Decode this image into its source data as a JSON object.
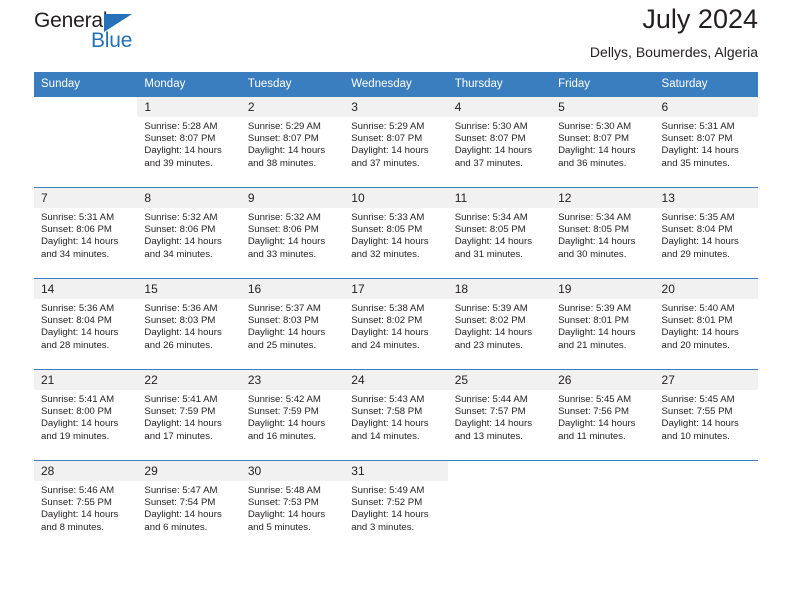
{
  "brand": {
    "name_dark": "General",
    "name_blue": "Blue",
    "accent_color": "#2572b8"
  },
  "header": {
    "title": "July 2024",
    "subtitle": "Dellys, Boumerdes, Algeria"
  },
  "colors": {
    "header_row": "#3a7ebf",
    "day_number_band": "#f1f1f1",
    "text": "#231f20"
  },
  "weekday_headers": [
    "Sunday",
    "Monday",
    "Tuesday",
    "Wednesday",
    "Thursday",
    "Friday",
    "Saturday"
  ],
  "weeks": [
    [
      {
        "day": "",
        "sunrise": "",
        "sunset": "",
        "daylight_line1": "",
        "daylight_line2": ""
      },
      {
        "day": "1",
        "sunrise": "Sunrise: 5:28 AM",
        "sunset": "Sunset: 8:07 PM",
        "daylight_line1": "Daylight: 14 hours",
        "daylight_line2": "and 39 minutes."
      },
      {
        "day": "2",
        "sunrise": "Sunrise: 5:29 AM",
        "sunset": "Sunset: 8:07 PM",
        "daylight_line1": "Daylight: 14 hours",
        "daylight_line2": "and 38 minutes."
      },
      {
        "day": "3",
        "sunrise": "Sunrise: 5:29 AM",
        "sunset": "Sunset: 8:07 PM",
        "daylight_line1": "Daylight: 14 hours",
        "daylight_line2": "and 37 minutes."
      },
      {
        "day": "4",
        "sunrise": "Sunrise: 5:30 AM",
        "sunset": "Sunset: 8:07 PM",
        "daylight_line1": "Daylight: 14 hours",
        "daylight_line2": "and 37 minutes."
      },
      {
        "day": "5",
        "sunrise": "Sunrise: 5:30 AM",
        "sunset": "Sunset: 8:07 PM",
        "daylight_line1": "Daylight: 14 hours",
        "daylight_line2": "and 36 minutes."
      },
      {
        "day": "6",
        "sunrise": "Sunrise: 5:31 AM",
        "sunset": "Sunset: 8:07 PM",
        "daylight_line1": "Daylight: 14 hours",
        "daylight_line2": "and 35 minutes."
      }
    ],
    [
      {
        "day": "7",
        "sunrise": "Sunrise: 5:31 AM",
        "sunset": "Sunset: 8:06 PM",
        "daylight_line1": "Daylight: 14 hours",
        "daylight_line2": "and 34 minutes."
      },
      {
        "day": "8",
        "sunrise": "Sunrise: 5:32 AM",
        "sunset": "Sunset: 8:06 PM",
        "daylight_line1": "Daylight: 14 hours",
        "daylight_line2": "and 34 minutes."
      },
      {
        "day": "9",
        "sunrise": "Sunrise: 5:32 AM",
        "sunset": "Sunset: 8:06 PM",
        "daylight_line1": "Daylight: 14 hours",
        "daylight_line2": "and 33 minutes."
      },
      {
        "day": "10",
        "sunrise": "Sunrise: 5:33 AM",
        "sunset": "Sunset: 8:05 PM",
        "daylight_line1": "Daylight: 14 hours",
        "daylight_line2": "and 32 minutes."
      },
      {
        "day": "11",
        "sunrise": "Sunrise: 5:34 AM",
        "sunset": "Sunset: 8:05 PM",
        "daylight_line1": "Daylight: 14 hours",
        "daylight_line2": "and 31 minutes."
      },
      {
        "day": "12",
        "sunrise": "Sunrise: 5:34 AM",
        "sunset": "Sunset: 8:05 PM",
        "daylight_line1": "Daylight: 14 hours",
        "daylight_line2": "and 30 minutes."
      },
      {
        "day": "13",
        "sunrise": "Sunrise: 5:35 AM",
        "sunset": "Sunset: 8:04 PM",
        "daylight_line1": "Daylight: 14 hours",
        "daylight_line2": "and 29 minutes."
      }
    ],
    [
      {
        "day": "14",
        "sunrise": "Sunrise: 5:36 AM",
        "sunset": "Sunset: 8:04 PM",
        "daylight_line1": "Daylight: 14 hours",
        "daylight_line2": "and 28 minutes."
      },
      {
        "day": "15",
        "sunrise": "Sunrise: 5:36 AM",
        "sunset": "Sunset: 8:03 PM",
        "daylight_line1": "Daylight: 14 hours",
        "daylight_line2": "and 26 minutes."
      },
      {
        "day": "16",
        "sunrise": "Sunrise: 5:37 AM",
        "sunset": "Sunset: 8:03 PM",
        "daylight_line1": "Daylight: 14 hours",
        "daylight_line2": "and 25 minutes."
      },
      {
        "day": "17",
        "sunrise": "Sunrise: 5:38 AM",
        "sunset": "Sunset: 8:02 PM",
        "daylight_line1": "Daylight: 14 hours",
        "daylight_line2": "and 24 minutes."
      },
      {
        "day": "18",
        "sunrise": "Sunrise: 5:39 AM",
        "sunset": "Sunset: 8:02 PM",
        "daylight_line1": "Daylight: 14 hours",
        "daylight_line2": "and 23 minutes."
      },
      {
        "day": "19",
        "sunrise": "Sunrise: 5:39 AM",
        "sunset": "Sunset: 8:01 PM",
        "daylight_line1": "Daylight: 14 hours",
        "daylight_line2": "and 21 minutes."
      },
      {
        "day": "20",
        "sunrise": "Sunrise: 5:40 AM",
        "sunset": "Sunset: 8:01 PM",
        "daylight_line1": "Daylight: 14 hours",
        "daylight_line2": "and 20 minutes."
      }
    ],
    [
      {
        "day": "21",
        "sunrise": "Sunrise: 5:41 AM",
        "sunset": "Sunset: 8:00 PM",
        "daylight_line1": "Daylight: 14 hours",
        "daylight_line2": "and 19 minutes."
      },
      {
        "day": "22",
        "sunrise": "Sunrise: 5:41 AM",
        "sunset": "Sunset: 7:59 PM",
        "daylight_line1": "Daylight: 14 hours",
        "daylight_line2": "and 17 minutes."
      },
      {
        "day": "23",
        "sunrise": "Sunrise: 5:42 AM",
        "sunset": "Sunset: 7:59 PM",
        "daylight_line1": "Daylight: 14 hours",
        "daylight_line2": "and 16 minutes."
      },
      {
        "day": "24",
        "sunrise": "Sunrise: 5:43 AM",
        "sunset": "Sunset: 7:58 PM",
        "daylight_line1": "Daylight: 14 hours",
        "daylight_line2": "and 14 minutes."
      },
      {
        "day": "25",
        "sunrise": "Sunrise: 5:44 AM",
        "sunset": "Sunset: 7:57 PM",
        "daylight_line1": "Daylight: 14 hours",
        "daylight_line2": "and 13 minutes."
      },
      {
        "day": "26",
        "sunrise": "Sunrise: 5:45 AM",
        "sunset": "Sunset: 7:56 PM",
        "daylight_line1": "Daylight: 14 hours",
        "daylight_line2": "and 11 minutes."
      },
      {
        "day": "27",
        "sunrise": "Sunrise: 5:45 AM",
        "sunset": "Sunset: 7:55 PM",
        "daylight_line1": "Daylight: 14 hours",
        "daylight_line2": "and 10 minutes."
      }
    ],
    [
      {
        "day": "28",
        "sunrise": "Sunrise: 5:46 AM",
        "sunset": "Sunset: 7:55 PM",
        "daylight_line1": "Daylight: 14 hours",
        "daylight_line2": "and 8 minutes."
      },
      {
        "day": "29",
        "sunrise": "Sunrise: 5:47 AM",
        "sunset": "Sunset: 7:54 PM",
        "daylight_line1": "Daylight: 14 hours",
        "daylight_line2": "and 6 minutes."
      },
      {
        "day": "30",
        "sunrise": "Sunrise: 5:48 AM",
        "sunset": "Sunset: 7:53 PM",
        "daylight_line1": "Daylight: 14 hours",
        "daylight_line2": "and 5 minutes."
      },
      {
        "day": "31",
        "sunrise": "Sunrise: 5:49 AM",
        "sunset": "Sunset: 7:52 PM",
        "daylight_line1": "Daylight: 14 hours",
        "daylight_line2": "and 3 minutes."
      },
      {
        "day": "",
        "sunrise": "",
        "sunset": "",
        "daylight_line1": "",
        "daylight_line2": ""
      },
      {
        "day": "",
        "sunrise": "",
        "sunset": "",
        "daylight_line1": "",
        "daylight_line2": ""
      },
      {
        "day": "",
        "sunrise": "",
        "sunset": "",
        "daylight_line1": "",
        "daylight_line2": ""
      }
    ]
  ]
}
